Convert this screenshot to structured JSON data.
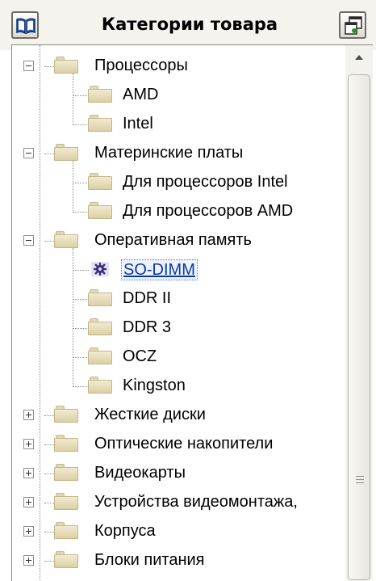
{
  "header": {
    "title": "Категории товара",
    "left_icon": "book-icon",
    "right_icon": "window-icon"
  },
  "tree": {
    "items": [
      {
        "label": "Процессоры",
        "level": 0,
        "state": "expanded"
      },
      {
        "label": "AMD",
        "level": 1
      },
      {
        "label": "Intel",
        "level": 1
      },
      {
        "label": "Материнские платы",
        "level": 0,
        "state": "expanded"
      },
      {
        "label": "Для процессоров Intel",
        "level": 1
      },
      {
        "label": "Для процессоров AMD",
        "level": 1
      },
      {
        "label": "Оперативная память",
        "level": 0,
        "state": "expanded"
      },
      {
        "label": "SO-DIMM",
        "level": 1,
        "selected": true,
        "icon": "gear-icon"
      },
      {
        "label": "DDR II",
        "level": 1
      },
      {
        "label": "DDR 3",
        "level": 1
      },
      {
        "label": "OCZ",
        "level": 1
      },
      {
        "label": "Kingston",
        "level": 1
      },
      {
        "label": "Жесткие  диски",
        "level": 0,
        "state": "collapsed"
      },
      {
        "label": "Оптические накопители",
        "level": 0,
        "state": "collapsed"
      },
      {
        "label": "Видеокарты",
        "level": 0,
        "state": "collapsed"
      },
      {
        "label": "Устройства видеомонтажа,",
        "level": 0,
        "state": "collapsed"
      },
      {
        "label": "Корпуса",
        "level": 0,
        "state": "collapsed"
      },
      {
        "label": "Блоки питания",
        "level": 0,
        "state": "collapsed"
      }
    ]
  },
  "scrollbar": {
    "up_icon": "scroll-up-arrow-icon",
    "grip_icon": "scroll-grip-icon"
  }
}
